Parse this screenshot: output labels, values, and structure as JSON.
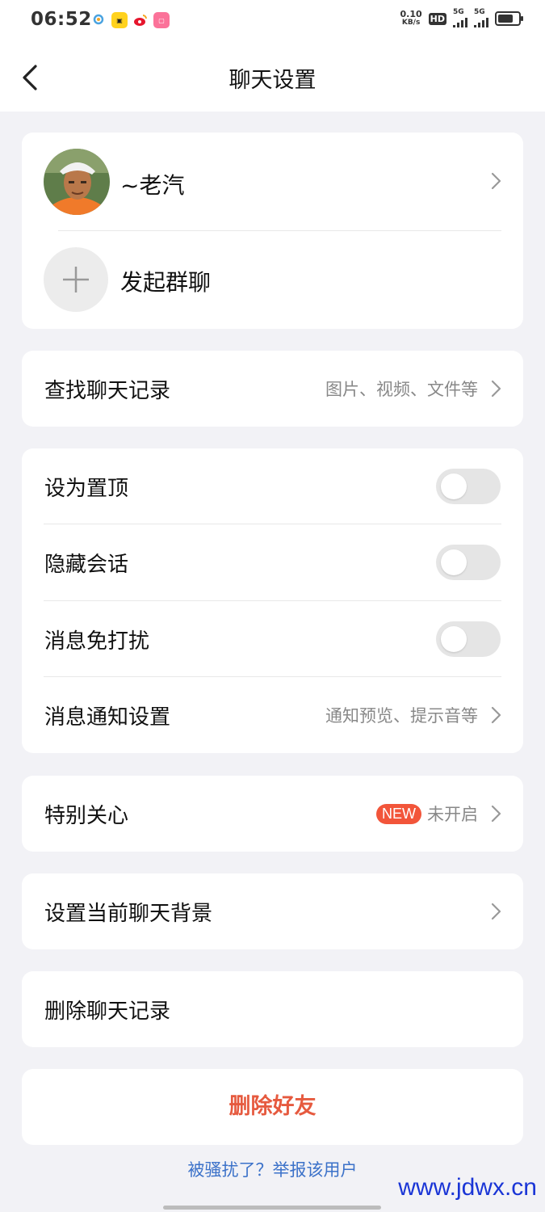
{
  "status_bar": {
    "time": "06:52",
    "net_speed_value": "0.10",
    "net_speed_unit": "KB/s",
    "hd": "HD",
    "signal1": "5G",
    "signal2": "5G",
    "app_icons": [
      "ring-app-icon",
      "yellow-app-icon",
      "weibo-icon",
      "bilibili-icon"
    ]
  },
  "header": {
    "title": "聊天设置"
  },
  "contact": {
    "name": "~老汽",
    "group_chat_label": "发起群聊"
  },
  "search_history": {
    "label": "查找聊天记录",
    "hint": "图片、视频、文件等"
  },
  "toggles": [
    {
      "label": "设为置顶",
      "on": false
    },
    {
      "label": "隐藏会话",
      "on": false
    },
    {
      "label": "消息免打扰",
      "on": false
    }
  ],
  "notify_settings": {
    "label": "消息通知设置",
    "hint": "通知预览、提示音等"
  },
  "special_care": {
    "label": "特别关心",
    "badge": "NEW",
    "hint": "未开启"
  },
  "chat_background": {
    "label": "设置当前聊天背景"
  },
  "delete_history": {
    "label": "删除聊天记录"
  },
  "delete_friend": {
    "label": "删除好友"
  },
  "report": {
    "label": "被骚扰了？举报该用户"
  },
  "watermark": {
    "text": "www.jdwx.cn"
  },
  "colors": {
    "background": "#f2f2f6",
    "danger": "#e65a3f",
    "link": "#3c72c9",
    "badge": "#f2553a"
  }
}
